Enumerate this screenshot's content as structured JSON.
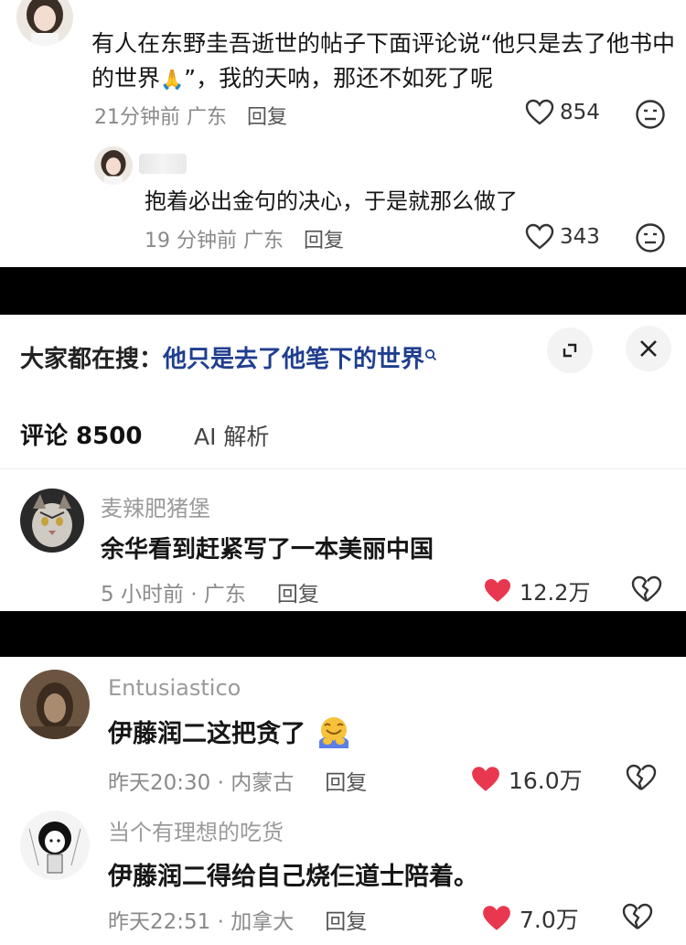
{
  "top_panel": {
    "comment1": {
      "text_line1": "有人在东野圭吾逝世的帖子下面评论说“他只是去了他书中",
      "text_line2a": "的世界",
      "emoji": "🙏",
      "text_line2b": "”，我的天呐，那还不如死了呢",
      "time_location": "21分钟前 广东",
      "reply_label": "回复",
      "likes": "854"
    },
    "comment2": {
      "text": "抱着必出金句的决心，于是就那么做了",
      "time_location": "19 分钟前 广东",
      "reply_label": "回复",
      "likes": "343"
    }
  },
  "search_panel": {
    "prefix": "大家都在搜：",
    "query": "他只是去了他笔下的世界",
    "tabs": [
      {
        "label": "评论 8500"
      },
      {
        "label": "AI 解析"
      }
    ],
    "comment": {
      "username": "麦辣肥猪堡",
      "text": "余华看到赶紧写了一本美丽中国",
      "time_location": "5 小时前 · 广东",
      "reply_label": "回复",
      "likes": "12.2万"
    }
  },
  "bottom_panel": {
    "comments": [
      {
        "username": "Entusiastico",
        "text": "伊藤润二这把贪了",
        "time_location": "昨天20:30 · 内蒙古",
        "reply_label": "回复",
        "likes": "16.0万"
      },
      {
        "username": "当个有理想的吃货",
        "text": "伊藤润二得给自己烧仨道士陪着。",
        "time_location": "昨天22:51 · 加拿大",
        "reply_label": "回复",
        "likes": "7.0万"
      }
    ]
  },
  "colors": {
    "liked_red": "#e8384f",
    "query_blue": "#1f3e8f",
    "meta_gray": "#8a8a8a"
  }
}
